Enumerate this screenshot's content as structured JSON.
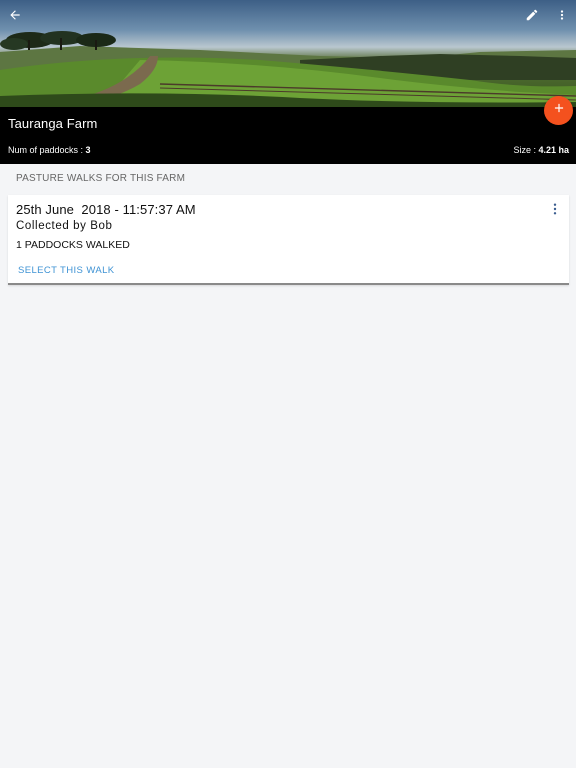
{
  "header": {
    "icons": {
      "back": "arrow-left-icon",
      "edit": "pencil-icon",
      "more": "more-vert-icon"
    }
  },
  "farm": {
    "name": "Tauranga Farm",
    "paddock_label": "Num of paddocks : ",
    "paddock_count": "3",
    "size_label": "Size : ",
    "size_value": "4.21 ha"
  },
  "fab": {
    "icon": "plus-icon",
    "color": "#f4511e"
  },
  "section": {
    "title": "PASTURE WALKS FOR THIS FARM"
  },
  "walks": [
    {
      "date": "25th June  2018 - 11:57:37 AM",
      "collector": "Collected by Bob",
      "paddocks": "1 PADDOCKS WALKED",
      "action": "SELECT THIS WALK"
    }
  ],
  "colors": {
    "accent": "#f4511e",
    "link": "#3f93d4",
    "info_bar": "#000000",
    "background": "#f4f5f7"
  }
}
